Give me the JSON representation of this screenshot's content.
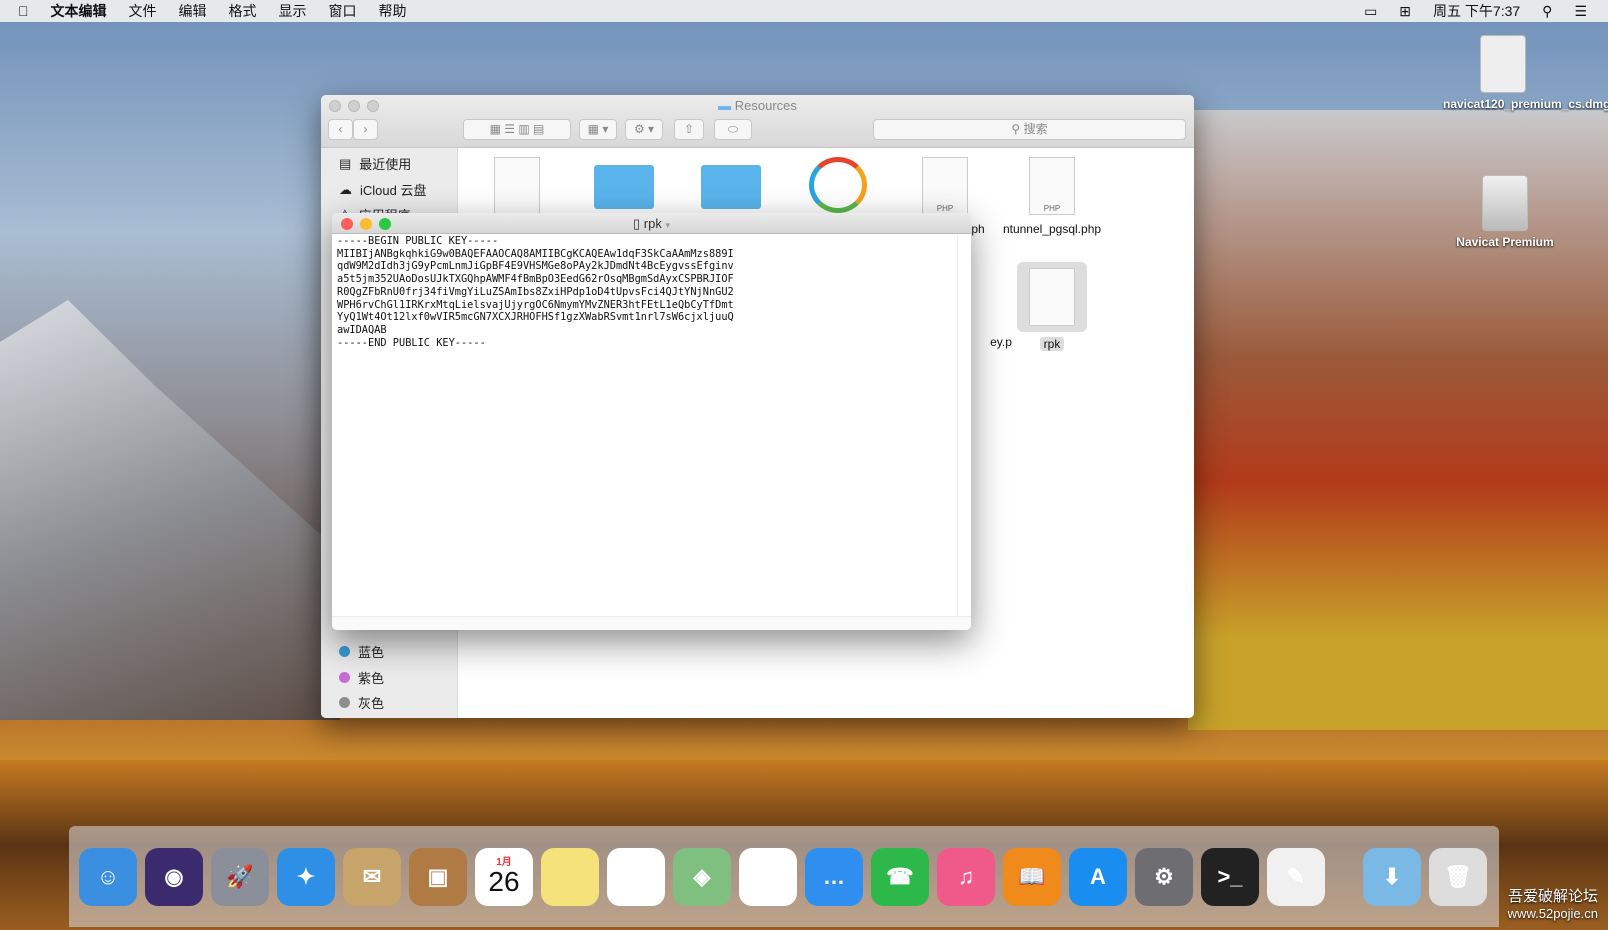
{
  "menubar": {
    "app": "文本编辑",
    "items": [
      "文件",
      "编辑",
      "格式",
      "显示",
      "窗口",
      "帮助"
    ],
    "clock": "周五 下午7:37"
  },
  "desktop": {
    "icons": [
      {
        "label": "navicat120_premium_cs.dmg"
      },
      {
        "label": "Navicat Premium"
      }
    ]
  },
  "finder": {
    "title": "Resources",
    "search_placeholder": "搜索",
    "sidebar": {
      "items": [
        "最近使用",
        "iCloud 云盘",
        "应用程序"
      ],
      "tags": [
        {
          "label": "蓝色",
          "color": "#3a9ad9"
        },
        {
          "label": "紫色",
          "color": "#c86ad7"
        },
        {
          "label": "灰色",
          "color": "#8e8e8e"
        }
      ]
    },
    "files": [
      {
        "label": "",
        "kind": "file"
      },
      {
        "label": "",
        "kind": "folder"
      },
      {
        "label": "",
        "kind": "folder"
      },
      {
        "label": "",
        "kind": "app"
      },
      {
        "label": "l.ph",
        "kind": "php"
      },
      {
        "label": "ntunnel_pgsql.php",
        "kind": "php"
      },
      {
        "label": "ey.p",
        "kind": "file"
      },
      {
        "label": "rpk",
        "kind": "file"
      }
    ]
  },
  "editor": {
    "title": "rpk",
    "content": "-----BEGIN PUBLIC KEY-----\nMIIBIjANBgkqhkiG9w0BAQEFAAOCAQ8AMIIBCgKCAQEAw1dqF3SkCaAAmMzs889I\nqdW9M2dIdh3jG9yPcmLnmJiGpBF4E9VHSMGe8oPAy2kJDmdNt4BcEygvssEfginv\na5t5jm352UAoDosUJkTXGQhpAWMF4fBmBpO3EedG62rOsqMBgmSdAyxCSPBRJIOF\nR0QgZFbRnU0frj34fiVmgYiLuZSAmIbs8ZxiHPdp1oD4tUpvsFci4QJtYNjNnGU2\nWPH6rvChGl1IRKrxMtqLielsvajUjyrgOC6NmymYMvZNER3htFEtL1eQbCyTfDmt\nYyQ1Wt4Ot12lxf0wVIR5mcGN7XCXJRHOFHSf1gzXWabRSvmt1nrl7sW6cjxljuuQ\nawIDAQAB\n-----END PUBLIC KEY-----"
  },
  "dock": {
    "apps": [
      "Finder",
      "Siri",
      "Launchpad",
      "Safari",
      "Mail",
      "Contacts",
      "Calendar",
      "Notes",
      "Reminders",
      "Maps",
      "Photos",
      "Messages",
      "FaceTime",
      "iTunes",
      "iBooks",
      "App Store",
      "System Preferences",
      "Terminal",
      "TextEdit",
      "Downloads",
      "Trash"
    ],
    "calendar_month": "1月",
    "calendar_day": "26"
  },
  "watermark": {
    "line1": "吾爱破解论坛",
    "line2": "www.52pojie.cn"
  }
}
